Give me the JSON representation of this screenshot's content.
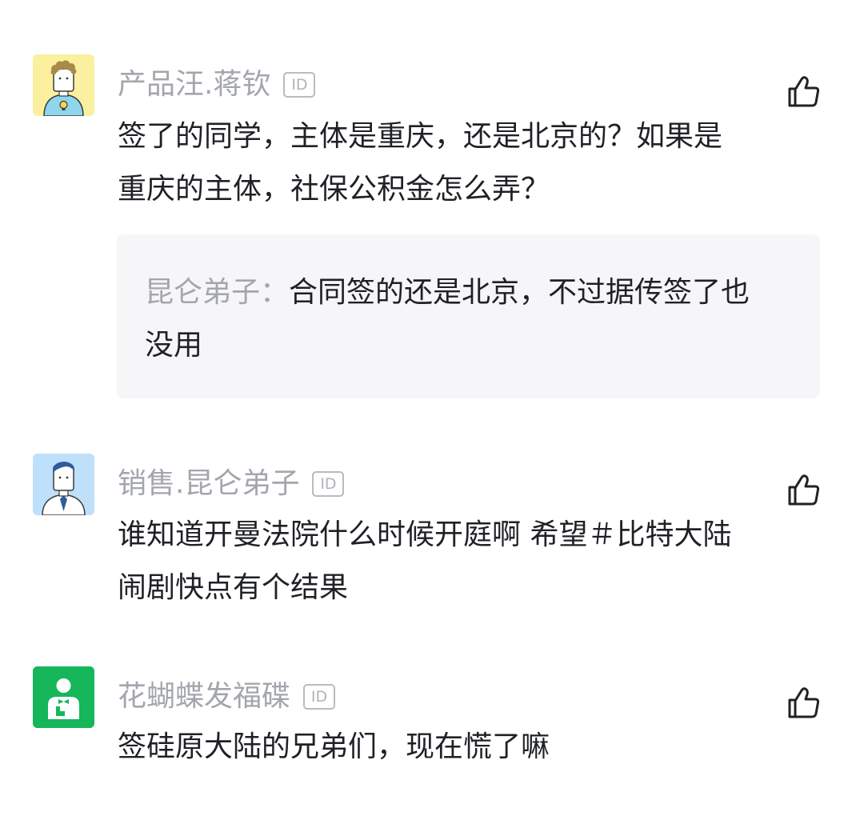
{
  "comments": [
    {
      "username": "产品汪.蒋钦",
      "id_badge": "ID",
      "avatar_icon": "product-manager-avatar-icon",
      "text_lines": [
        "签了的同学，主体是重庆，还是北京的？如果是",
        "重庆的主体，社保公积金怎么弄？"
      ],
      "reply": {
        "author": "昆仑弟子：",
        "text_line1": "合同签的还是北京，不过据传签了也",
        "text_line2": "没用"
      }
    },
    {
      "username": "销售.昆仑弟子",
      "id_badge": "ID",
      "avatar_icon": "salesperson-avatar-icon",
      "text_lines": [
        "谁知道开曼法院什么时候开庭啊 希望＃比特大陆",
        "闹剧快点有个结果"
      ]
    },
    {
      "username": "花蝴蝶发福碟",
      "id_badge": "ID",
      "avatar_icon": "waiter-avatar-icon",
      "text_lines": [
        "签硅原大陆的兄弟们，现在慌了嘛"
      ]
    }
  ],
  "colors": {
    "username": "#a3a6ad",
    "body_text": "#1f2126",
    "reply_bg": "#f6f6f8",
    "avatar1_bg": "#fbf0a0",
    "avatar2_bg": "#bfe0fb",
    "avatar3_bg": "#16b65a"
  },
  "icons": {
    "like": "thumbs-up-icon"
  }
}
